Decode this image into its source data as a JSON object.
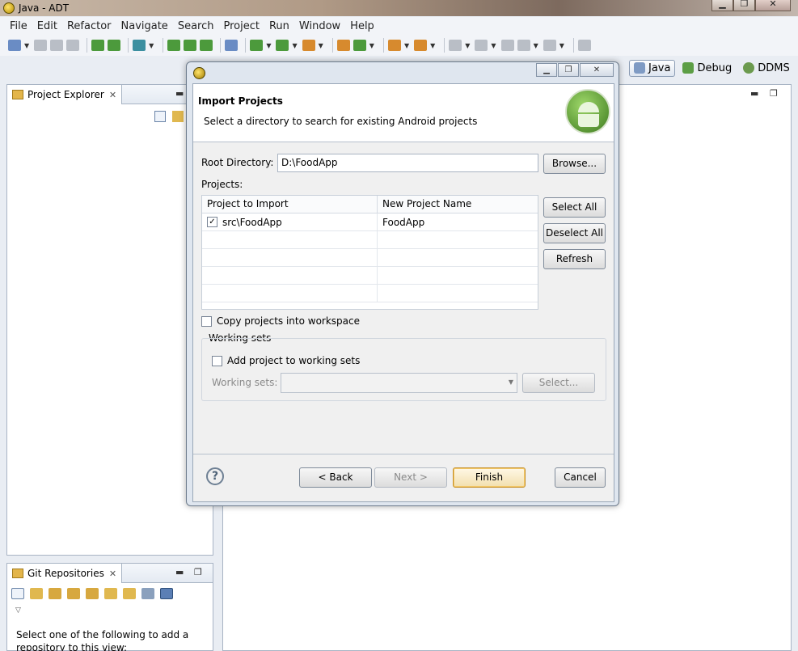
{
  "window": {
    "title": "Java - ADT"
  },
  "menu": [
    "File",
    "Edit",
    "Refactor",
    "Navigate",
    "Search",
    "Project",
    "Run",
    "Window",
    "Help"
  ],
  "perspectives": [
    {
      "label": "Java",
      "active": true
    },
    {
      "label": "Debug",
      "active": false
    },
    {
      "label": "DDMS",
      "active": false
    }
  ],
  "project_explorer": {
    "tab_label": "Project Explorer"
  },
  "git_repositories": {
    "tab_label": "Git Repositories",
    "message": "Select one of the following to add a repository to this view:"
  },
  "dialog": {
    "header_title": "Import Projects",
    "header_message": "Select a directory to search for existing Android projects",
    "root_directory_label": "Root Directory:",
    "root_directory_value": "D:\\FoodApp",
    "browse_label": "Browse...",
    "projects_label": "Projects:",
    "columns": [
      "Project to Import",
      "New Project Name"
    ],
    "rows": [
      {
        "project": "src\\FoodApp",
        "name": "FoodApp",
        "checked": true
      }
    ],
    "select_all_label": "Select All",
    "deselect_all_label": "Deselect All",
    "refresh_label": "Refresh",
    "copy_projects_label": "Copy projects into workspace",
    "working_sets_group_label": "Working sets",
    "add_to_working_sets_label": "Add project to working sets",
    "working_sets_field_label": "Working sets:",
    "working_sets_select_label": "Select...",
    "back_label": "< Back",
    "next_label": "Next >",
    "finish_label": "Finish",
    "cancel_label": "Cancel"
  }
}
